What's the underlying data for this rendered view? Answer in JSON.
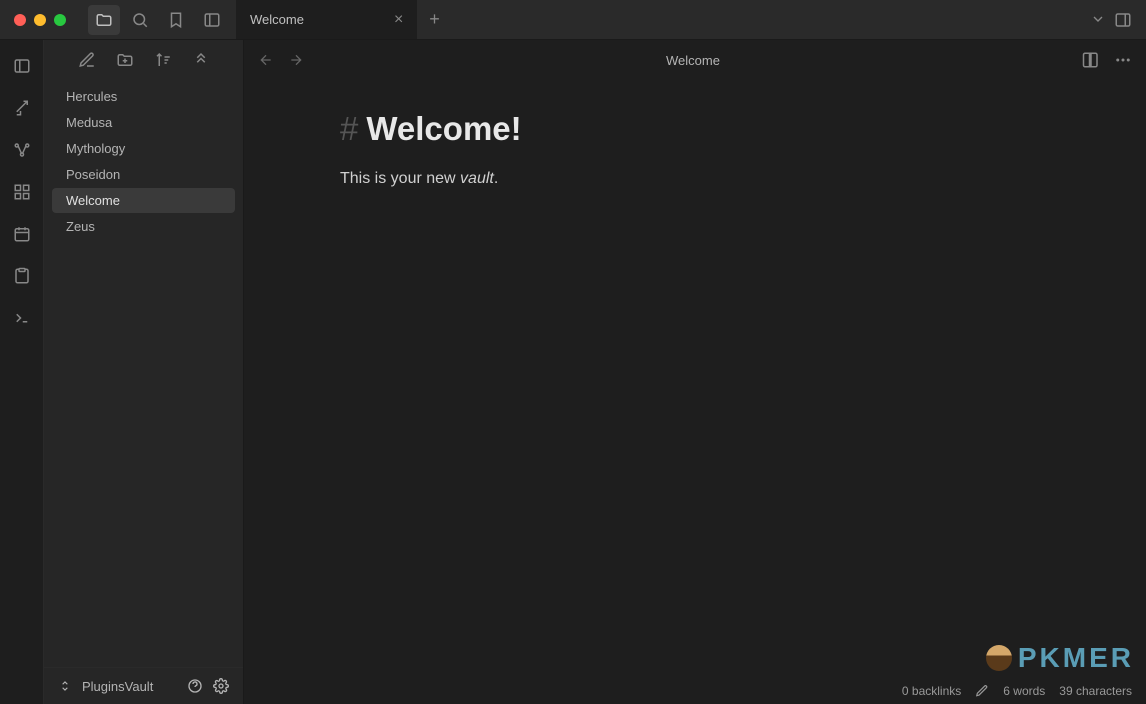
{
  "titlebar": {
    "tab_label": "Welcome"
  },
  "sidebar": {
    "files": [
      {
        "name": "Hercules",
        "selected": false
      },
      {
        "name": "Medusa",
        "selected": false
      },
      {
        "name": "Mythology",
        "selected": false
      },
      {
        "name": "Poseidon",
        "selected": false
      },
      {
        "name": "Welcome",
        "selected": true
      },
      {
        "name": "Zeus",
        "selected": false
      }
    ],
    "vault_name": "PluginsVault"
  },
  "content": {
    "title": "Welcome",
    "heading": "Welcome!",
    "body_prefix": "This is your new ",
    "body_italic": "vault",
    "body_suffix": "."
  },
  "statusbar": {
    "backlinks": "0 backlinks",
    "words": "6 words",
    "chars": "39 characters"
  },
  "watermark": {
    "text": "PKMER"
  }
}
